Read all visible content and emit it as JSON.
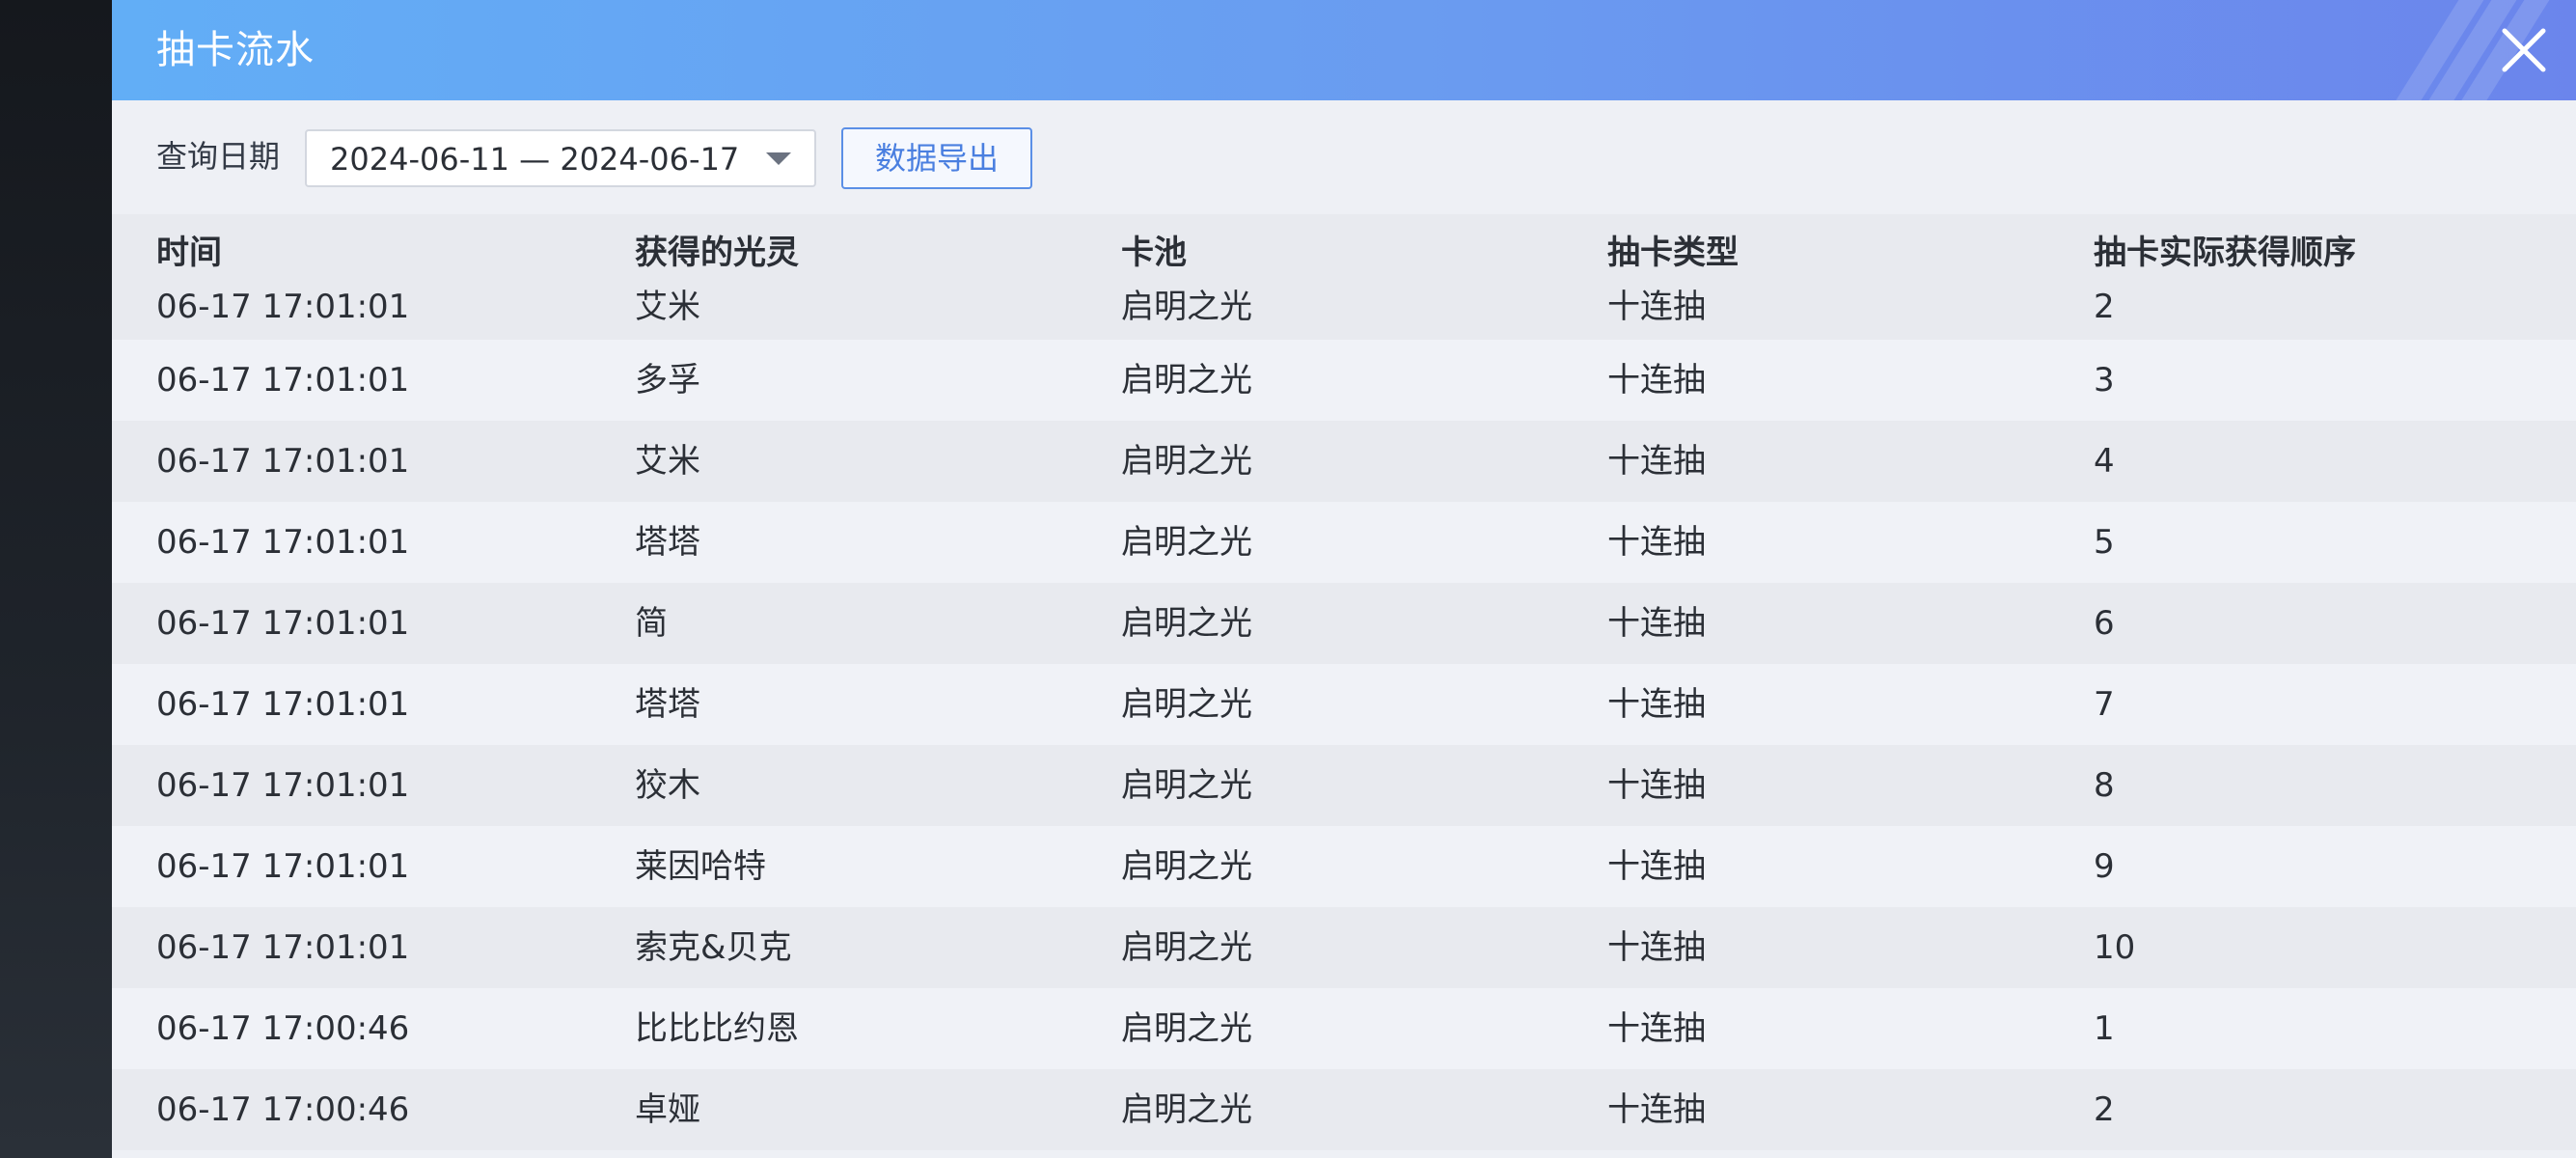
{
  "dialog": {
    "title": "抽卡流水",
    "close_icon": "close-icon"
  },
  "filter": {
    "date_label": "查询日期",
    "date_range": "2024-06-11 — 2024-06-17",
    "export_label": "数据导出"
  },
  "table": {
    "headers": [
      "时间",
      "获得的光灵",
      "卡池",
      "抽卡类型",
      "抽卡实际获得顺序"
    ],
    "rows": [
      [
        "06-17 17:01:01",
        "艾米",
        "启明之光",
        "十连抽",
        "2"
      ],
      [
        "06-17 17:01:01",
        "多孚",
        "启明之光",
        "十连抽",
        "3"
      ],
      [
        "06-17 17:01:01",
        "艾米",
        "启明之光",
        "十连抽",
        "4"
      ],
      [
        "06-17 17:01:01",
        "塔塔",
        "启明之光",
        "十连抽",
        "5"
      ],
      [
        "06-17 17:01:01",
        "简",
        "启明之光",
        "十连抽",
        "6"
      ],
      [
        "06-17 17:01:01",
        "塔塔",
        "启明之光",
        "十连抽",
        "7"
      ],
      [
        "06-17 17:01:01",
        "狡木",
        "启明之光",
        "十连抽",
        "8"
      ],
      [
        "06-17 17:01:01",
        "莱因哈特",
        "启明之光",
        "十连抽",
        "9"
      ],
      [
        "06-17 17:01:01",
        "索克&贝克",
        "启明之光",
        "十连抽",
        "10"
      ],
      [
        "06-17 17:00:46",
        "比比比约恩",
        "启明之光",
        "十连抽",
        "1"
      ],
      [
        "06-17 17:00:46",
        "卓娅",
        "启明之光",
        "十连抽",
        "2"
      ]
    ]
  },
  "colors": {
    "header_gradient_start": "#62aef6",
    "header_gradient_end": "#6b85ec",
    "accent": "#4a7fe0",
    "row_alt": "#e8eaef",
    "row_base": "#f0f2f7"
  }
}
